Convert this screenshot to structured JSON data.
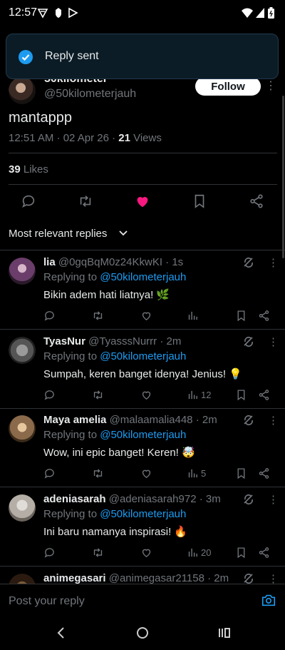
{
  "status_bar": {
    "time": "12:57"
  },
  "toast": {
    "text": "Reply sent"
  },
  "tweet": {
    "author_name": "50kilometer",
    "author_handle": "@50kilometerjauh",
    "follow_label": "Follow",
    "text": "mantappp",
    "meta_prefix": "12:51 AM · 02 Apr 26 · ",
    "views_count": "21",
    "views_label": " Views",
    "likes_count": "39",
    "likes_label": " Likes",
    "liked_color": "#f91880"
  },
  "sort": {
    "label": "Most relevant replies"
  },
  "replies": [
    {
      "name": "lia",
      "handle": "@0gqBqM0z24KkwKI",
      "time": "· 1s",
      "replying_prefix": "Replying to ",
      "replying_to": "@50kilometerjauh",
      "text": "Bikin adem hati liatnya! 🌿",
      "views": ""
    },
    {
      "name": "TyasNur",
      "handle": "@TyasssNurrr",
      "time": "· 2m",
      "replying_prefix": "Replying to ",
      "replying_to": "@50kilometerjauh",
      "text": "Sumpah, keren banget idenya! Jenius! 💡",
      "views": "12"
    },
    {
      "name": "Maya amelia",
      "handle": "@malaamalia448",
      "time": "· 2m",
      "replying_prefix": "Replying to ",
      "replying_to": "@50kilometerjauh",
      "text": "Wow, ini epic banget! Keren! 🤯",
      "views": "5"
    },
    {
      "name": "adeniasarah",
      "handle": "@adeniasarah972",
      "time": "· 3m",
      "replying_prefix": "Replying to ",
      "replying_to": "@50kilometerjauh",
      "text": "Ini baru namanya inspirasi! 🔥",
      "views": "20"
    },
    {
      "name": "animegasari",
      "handle": "@animegasar21158",
      "time": "· 2m",
      "replying_prefix": "",
      "replying_to": "",
      "text": "",
      "views": ""
    }
  ],
  "composer": {
    "placeholder": "Post your reply"
  },
  "colors": {
    "link": "#1d9bf0",
    "muted": "#71767b",
    "toast_check": "#1d9bf0"
  },
  "icons": [
    "reply-icon",
    "retweet-icon",
    "like-icon",
    "views-icon",
    "bookmark-icon",
    "share-icon",
    "grok-icon",
    "more-icon",
    "camera-icon",
    "check-circle-icon"
  ]
}
